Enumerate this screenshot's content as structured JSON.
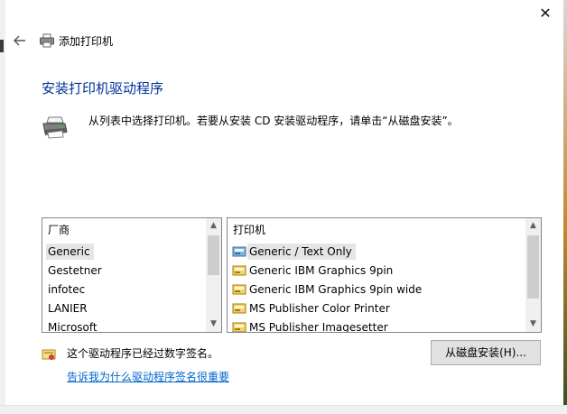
{
  "window": {
    "title": "添加打印机",
    "close_glyph": "✕",
    "back_glyph": "←"
  },
  "page": {
    "heading": "安装打印机驱动程序",
    "instruction": "从列表中选择打印机。若要从安装 CD 安装驱动程序，请单击“从磁盘安装”。"
  },
  "manufacturers": {
    "header": "厂商",
    "items": [
      "Generic",
      "Gestetner",
      "infotec",
      "LANIER",
      "Microsoft"
    ],
    "selected_index": 0
  },
  "printers": {
    "header": "打印机",
    "items": [
      "Generic / Text Only",
      "Generic IBM Graphics 9pin",
      "Generic IBM Graphics 9pin wide",
      "MS Publisher Color Printer",
      "MS Publisher Imagesetter"
    ],
    "selected_index": 0
  },
  "signature": {
    "status": "这个驱动程序已经过数字签名。",
    "link": "告诉我为什么驱动程序签名很重要"
  },
  "buttons": {
    "have_disk": "从磁盘安装(H)..."
  },
  "icons": {
    "back": "arrow-left-icon",
    "title": "printer-icon",
    "header": "printer-large-icon",
    "printer_item": "printer-driver-icon",
    "signature": "certificate-icon",
    "close": "close-icon"
  },
  "colors": {
    "heading": "#003399",
    "link": "#0066cc",
    "selection": "#e5e5e5"
  }
}
